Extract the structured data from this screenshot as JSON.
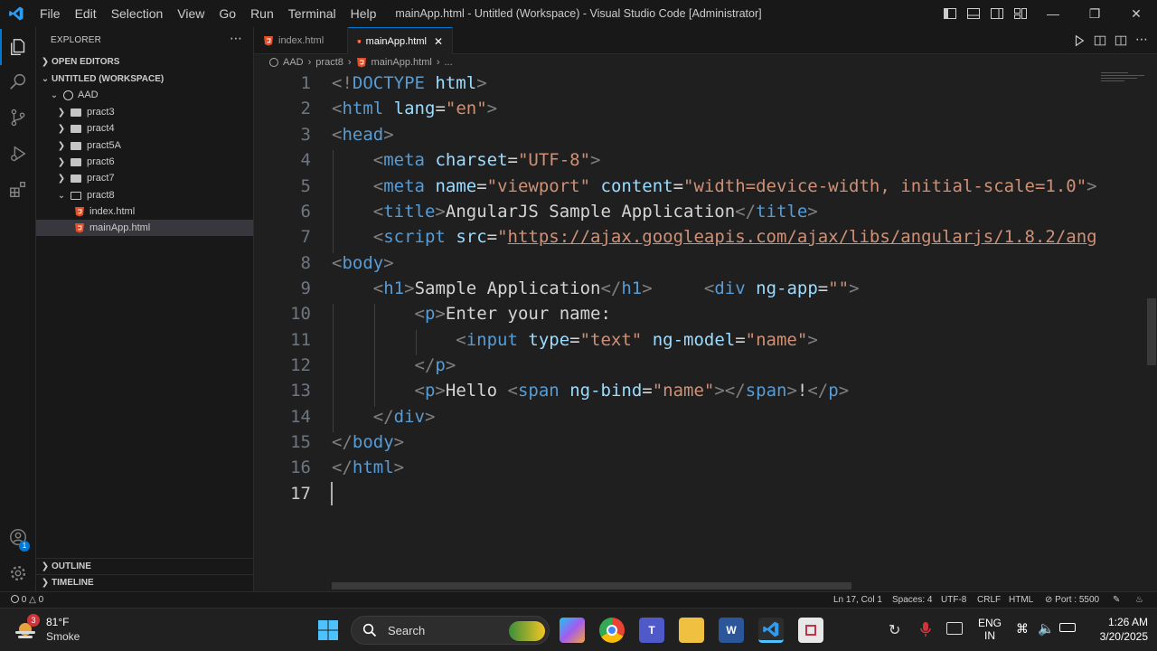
{
  "titlebar": {
    "menu": [
      "File",
      "Edit",
      "Selection",
      "View",
      "Go",
      "Run",
      "Terminal",
      "Help"
    ],
    "window_title": "mainApp.html - Untitled (Workspace) - Visual Studio Code [Administrator]"
  },
  "sidebar": {
    "header": "EXPLORER",
    "open_editors": "OPEN EDITORS",
    "workspace": "UNTITLED (WORKSPACE)",
    "root": "AAD",
    "folders": [
      "pract3",
      "pract4",
      "pract5A",
      "pract6",
      "pract7",
      "pract8"
    ],
    "files": [
      "index.html",
      "mainApp.html"
    ],
    "outline": "OUTLINE",
    "timeline": "TIMELINE"
  },
  "tabs": [
    {
      "label": "index.html"
    },
    {
      "label": "mainApp.html"
    }
  ],
  "breadcrumb": [
    "AAD",
    "pract8",
    "mainApp.html",
    "..."
  ],
  "editor": {
    "line_numbers": [
      "1",
      "2",
      "3",
      "4",
      "5",
      "6",
      "7",
      "8",
      "9",
      "10",
      "11",
      "12",
      "13",
      "14",
      "15",
      "16",
      "17"
    ],
    "current_line": "17"
  },
  "statusbar": {
    "problems": "0",
    "warnings": "0",
    "position": "Ln 17, Col 1",
    "spaces": "Spaces: 4",
    "encoding": "UTF-8",
    "eol": "CRLF",
    "language": "HTML",
    "port": "Port : 5500"
  },
  "taskbar": {
    "weather_temp": "81°F",
    "weather_desc": "Smoke",
    "weather_badge": "3",
    "search": "Search",
    "lang_top": "ENG",
    "lang_bottom": "IN",
    "time": "1:26 AM",
    "date": "3/20/2025"
  },
  "colors": {
    "accent": "#0078d4",
    "tag": "#569cd6",
    "attr": "#9cdcfe",
    "string": "#ce9178",
    "bg": "#1f1f1f"
  }
}
